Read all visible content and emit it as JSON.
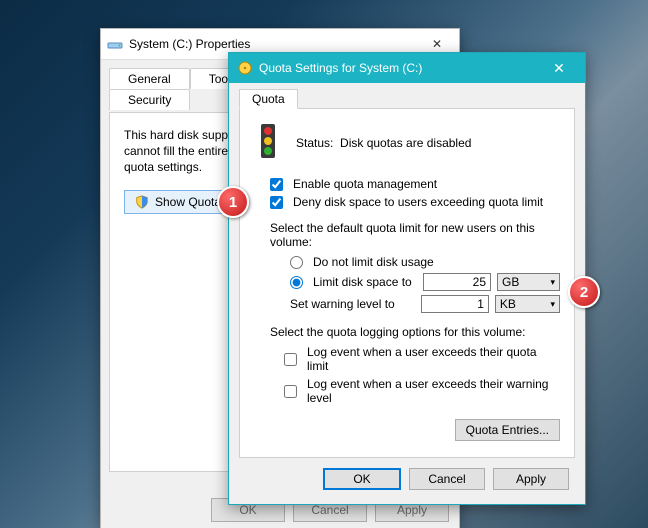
{
  "back_window": {
    "title": "System (C:) Properties",
    "tabs_row1": [
      "General",
      "Tools"
    ],
    "tabs_row2": [
      "Security"
    ],
    "body_text": "This hard disk supports user quotas. As a single user cannot fill the entire disk, you can view or change the quota settings.",
    "show_quota_btn": "Show Quota Settings",
    "buttons": {
      "ok": "OK",
      "cancel": "Cancel",
      "apply": "Apply"
    }
  },
  "front_window": {
    "title": "Quota Settings for System (C:)",
    "tab": "Quota",
    "status_label": "Status:",
    "status_value": "Disk quotas are disabled",
    "enable_label": "Enable quota management",
    "deny_label": "Deny disk space to users exceeding quota limit",
    "default_section": "Select the default quota limit for new users on this volume:",
    "opt_no_limit": "Do not limit disk usage",
    "opt_limit": "Limit disk space to",
    "limit_value": "25",
    "limit_unit": "GB",
    "warn_label": "Set warning level to",
    "warn_value": "1",
    "warn_unit": "KB",
    "logging_section": "Select the quota logging options for this volume:",
    "log_limit": "Log event when a user exceeds their quota limit",
    "log_warn": "Log event when a user exceeds their warning level",
    "quota_entries_btn": "Quota Entries...",
    "buttons": {
      "ok": "OK",
      "cancel": "Cancel",
      "apply": "Apply"
    }
  },
  "annotations": {
    "one": "1",
    "two": "2"
  }
}
